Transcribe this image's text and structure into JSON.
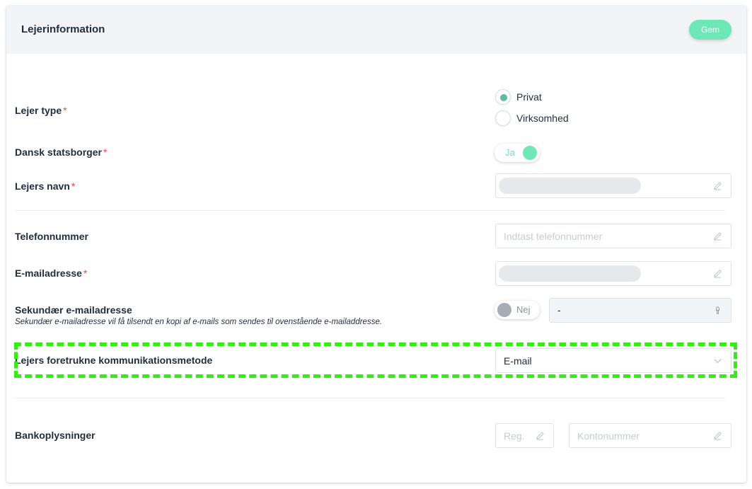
{
  "header": {
    "title": "Lejerinformation",
    "save_label": "Gem"
  },
  "required_mark": "*",
  "tenant_type": {
    "label": "Lejer type",
    "options": [
      {
        "label": "Privat",
        "checked": true
      },
      {
        "label": "Virksomhed",
        "checked": false
      }
    ]
  },
  "danish_citizen": {
    "label": "Dansk statsborger",
    "toggle_text": "Ja",
    "on": true
  },
  "tenant_name": {
    "label": "Lejers navn"
  },
  "phone": {
    "label": "Telefonnummer",
    "placeholder": "Indtast telefonnummer"
  },
  "email": {
    "label": "E-mailadresse"
  },
  "secondary_email": {
    "label": "Sekundær e-mailadresse",
    "toggle_text": "Nej",
    "on": false,
    "value": "-",
    "hint": "Sekundær e-mailadresse vil få tilsendt en kopi af e-mails som sendes til ovenstående e-mailaddresse."
  },
  "communication": {
    "label": "Lejers foretrukne kommunikationsmetode",
    "selected": "E-mail"
  },
  "bank": {
    "label": "Bankoplysninger",
    "reg_placeholder": "Reg.nr.",
    "account_placeholder": "Kontonummer"
  },
  "colors": {
    "accent": "#6ee7b7",
    "radio": "#5fb8a8",
    "required": "#ef4444",
    "highlight": "#33ee11"
  }
}
